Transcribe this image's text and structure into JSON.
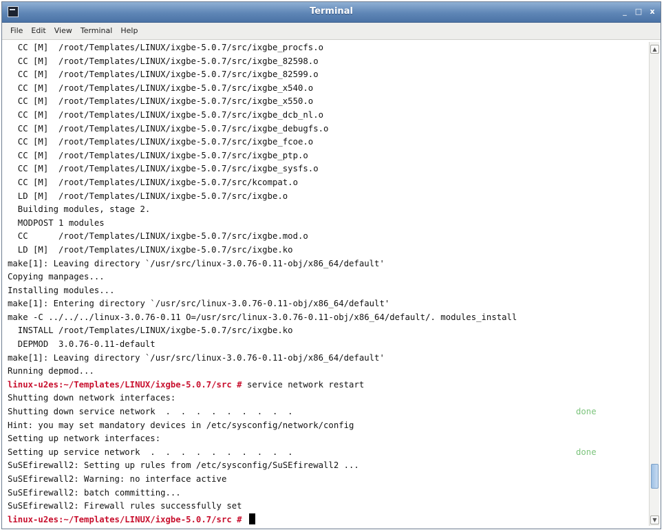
{
  "window": {
    "title": "Terminal",
    "icon": "terminal-app-icon",
    "controls": {
      "minimize": "_",
      "maximize": "□",
      "close": "x"
    }
  },
  "menu": [
    "File",
    "Edit",
    "View",
    "Terminal",
    "Help"
  ],
  "colors": {
    "prompt": "#c8102e",
    "done": "#7cc47c",
    "titlebar": "#5f86b6"
  },
  "terminal": {
    "lines": [
      {
        "text": "  CC [M]  /root/Templates/LINUX/ixgbe-5.0.7/src/ixgbe_procfs.o"
      },
      {
        "text": "  CC [M]  /root/Templates/LINUX/ixgbe-5.0.7/src/ixgbe_82598.o"
      },
      {
        "text": "  CC [M]  /root/Templates/LINUX/ixgbe-5.0.7/src/ixgbe_82599.o"
      },
      {
        "text": "  CC [M]  /root/Templates/LINUX/ixgbe-5.0.7/src/ixgbe_x540.o"
      },
      {
        "text": "  CC [M]  /root/Templates/LINUX/ixgbe-5.0.7/src/ixgbe_x550.o"
      },
      {
        "text": "  CC [M]  /root/Templates/LINUX/ixgbe-5.0.7/src/ixgbe_dcb_nl.o"
      },
      {
        "text": "  CC [M]  /root/Templates/LINUX/ixgbe-5.0.7/src/ixgbe_debugfs.o"
      },
      {
        "text": "  CC [M]  /root/Templates/LINUX/ixgbe-5.0.7/src/ixgbe_fcoe.o"
      },
      {
        "text": "  CC [M]  /root/Templates/LINUX/ixgbe-5.0.7/src/ixgbe_ptp.o"
      },
      {
        "text": "  CC [M]  /root/Templates/LINUX/ixgbe-5.0.7/src/ixgbe_sysfs.o"
      },
      {
        "text": "  CC [M]  /root/Templates/LINUX/ixgbe-5.0.7/src/kcompat.o"
      },
      {
        "text": "  LD [M]  /root/Templates/LINUX/ixgbe-5.0.7/src/ixgbe.o"
      },
      {
        "text": "  Building modules, stage 2."
      },
      {
        "text": "  MODPOST 1 modules"
      },
      {
        "text": "  CC      /root/Templates/LINUX/ixgbe-5.0.7/src/ixgbe.mod.o"
      },
      {
        "text": "  LD [M]  /root/Templates/LINUX/ixgbe-5.0.7/src/ixgbe.ko"
      },
      {
        "text": "make[1]: Leaving directory `/usr/src/linux-3.0.76-0.11-obj/x86_64/default'"
      },
      {
        "text": "Copying manpages..."
      },
      {
        "text": "Installing modules..."
      },
      {
        "text": "make[1]: Entering directory `/usr/src/linux-3.0.76-0.11-obj/x86_64/default'"
      },
      {
        "text": "make -C ../../../linux-3.0.76-0.11 O=/usr/src/linux-3.0.76-0.11-obj/x86_64/default/. modules_install"
      },
      {
        "text": "  INSTALL /root/Templates/LINUX/ixgbe-5.0.7/src/ixgbe.ko"
      },
      {
        "text": "  DEPMOD  3.0.76-0.11-default"
      },
      {
        "text": "make[1]: Leaving directory `/usr/src/linux-3.0.76-0.11-obj/x86_64/default'"
      },
      {
        "text": "Running depmod..."
      },
      {
        "prompt": "linux-u2es:~/Templates/LINUX/ixgbe-5.0.7/src # ",
        "text": "service network restart"
      },
      {
        "text": "Shutting down network interfaces:"
      },
      {
        "text": "Shutting down service network  .  .  .  .  .  .  .  .  .",
        "status": "done"
      },
      {
        "text": "Hint: you may set mandatory devices in /etc/sysconfig/network/config"
      },
      {
        "text": "Setting up network interfaces:"
      },
      {
        "text": "Setting up service network  .  .  .  .  .  .  .  .  .  .",
        "status": "done"
      },
      {
        "text": "SuSEfirewall2: Setting up rules from /etc/sysconfig/SuSEfirewall2 ..."
      },
      {
        "text": "SuSEfirewall2: Warning: no interface active"
      },
      {
        "text": "SuSEfirewall2: batch committing..."
      },
      {
        "text": "SuSEfirewall2: Firewall rules successfully set"
      },
      {
        "prompt": "linux-u2es:~/Templates/LINUX/ixgbe-5.0.7/src # ",
        "text": "",
        "cursor": true
      }
    ]
  },
  "scrollbar": {
    "position": 0.94
  }
}
